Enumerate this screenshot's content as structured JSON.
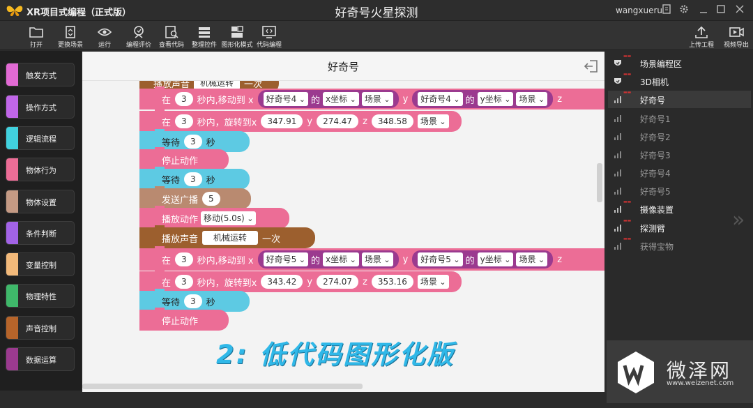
{
  "app": {
    "title": "XR项目式编程（正式版）",
    "window_title": "好奇号火星探测",
    "username": "wangxueru"
  },
  "titlebar_icons": [
    "document-icon",
    "gear-icon",
    "minimize-icon",
    "restore-icon",
    "close-icon"
  ],
  "toolbar": {
    "items": [
      {
        "label": "打开",
        "icon": "folder-icon"
      },
      {
        "label": "更换场景",
        "icon": "swap-scene-icon"
      },
      {
        "label": "运行",
        "icon": "eye-icon"
      },
      {
        "label": "编程评价",
        "icon": "evaluation-icon"
      },
      {
        "label": "查看代码",
        "icon": "view-code-icon"
      },
      {
        "label": "整理控件",
        "icon": "organize-icon"
      },
      {
        "label": "图形化模式",
        "icon": "graphic-mode-icon"
      },
      {
        "label": "代码编程",
        "icon": "code-editor-icon"
      }
    ],
    "right_items": [
      {
        "label": "上传工程",
        "icon": "upload-icon"
      },
      {
        "label": "视频导出",
        "icon": "video-export-icon"
      }
    ]
  },
  "palette": {
    "categories": [
      {
        "label": "触发方式",
        "color": "#e26ad4"
      },
      {
        "label": "操作方式",
        "color": "#c066e8"
      },
      {
        "label": "逻辑流程",
        "color": "#41d1de"
      },
      {
        "label": "物体行为",
        "color": "#ec6d96"
      },
      {
        "label": "物体设置",
        "color": "#c49a84"
      },
      {
        "label": "条件判断",
        "color": "#a263e6"
      },
      {
        "label": "变量控制",
        "color": "#f2b97a"
      },
      {
        "label": "物理特性",
        "color": "#3fb86a"
      },
      {
        "label": "声音控制",
        "color": "#b6642a"
      },
      {
        "label": "数据运算",
        "color": "#9b3a8f"
      }
    ]
  },
  "workspace": {
    "title": "好奇号",
    "blocks": {
      "top_cut": {
        "text": "播放声音",
        "sound": "机械运转",
        "suffix": "一次"
      },
      "move1": {
        "prefix": "在",
        "secs": "3",
        "mid": "秒内,移动到 x",
        "obj1": "好奇号4",
        "of1": "的",
        "axis1": "x坐标",
        "scene1": "场景",
        "y_label": "y",
        "obj2": "好奇号4",
        "of2": "的",
        "axis2": "y坐标",
        "scene2": "场景",
        "z_label": "z"
      },
      "rotate1": {
        "prefix": "在",
        "secs": "3",
        "mid": "秒内，旋转到x",
        "x": "347.91",
        "y_label": "y",
        "y": "274.47",
        "z_label": "z",
        "z": "348.58",
        "scene": "场景"
      },
      "wait1": {
        "prefix": "等待",
        "secs": "3",
        "suffix": "秒"
      },
      "stop1": {
        "text": "停止动作"
      },
      "wait2": {
        "prefix": "等待",
        "secs": "3",
        "suffix": "秒"
      },
      "broadcast": {
        "prefix": "发送广播",
        "value": "5"
      },
      "play_anim": {
        "prefix": "播放动作",
        "anim": "移动(5.0s)"
      },
      "sound": {
        "prefix": "播放声音",
        "sound": "机械运转",
        "suffix": "一次"
      },
      "move2": {
        "prefix": "在",
        "secs": "3",
        "mid": "秒内,移动到 x",
        "obj1": "好奇号5",
        "of1": "的",
        "axis1": "x坐标",
        "scene1": "场景",
        "y_label": "y",
        "obj2": "好奇号5",
        "of2": "的",
        "axis2": "y坐标",
        "scene2": "场景",
        "z_label": "z"
      },
      "rotate2": {
        "prefix": "在",
        "secs": "3",
        "mid": "秒内，旋转到x",
        "x": "343.42",
        "y_label": "y",
        "y": "274.07",
        "z_label": "z",
        "z": "353.16",
        "scene": "场景"
      },
      "wait3": {
        "prefix": "等待",
        "secs": "3",
        "suffix": "秒"
      },
      "stop2": {
        "text": "停止动作"
      }
    },
    "overlay_caption": "2: 低代码图形化版"
  },
  "scene_panel": {
    "items": [
      {
        "label": "场景编程区",
        "icon": "shield-icon",
        "level": 0,
        "selected": false
      },
      {
        "label": "3D相机",
        "icon": "shield-icon",
        "level": 0,
        "selected": false
      },
      {
        "label": "好奇号",
        "icon": "bars-icon",
        "level": 0,
        "selected": true
      },
      {
        "label": "好奇号1",
        "icon": "bars-icon",
        "level": 1,
        "selected": false
      },
      {
        "label": "好奇号2",
        "icon": "bars-icon",
        "level": 1,
        "selected": false
      },
      {
        "label": "好奇号3",
        "icon": "bars-icon",
        "level": 1,
        "selected": false
      },
      {
        "label": "好奇号4",
        "icon": "bars-icon",
        "level": 1,
        "selected": false
      },
      {
        "label": "好奇号5",
        "icon": "bars-icon",
        "level": 1,
        "selected": false
      },
      {
        "label": "摄像装置",
        "icon": "bars-icon",
        "level": 0,
        "selected": false
      },
      {
        "label": "探测臂",
        "icon": "bars-icon",
        "level": 0,
        "selected": false
      },
      {
        "label": "获得宝物",
        "icon": "bars-icon",
        "level": 1,
        "selected": false
      }
    ]
  },
  "watermark": {
    "name": "微泽网",
    "url": "www.weizenet.com"
  }
}
